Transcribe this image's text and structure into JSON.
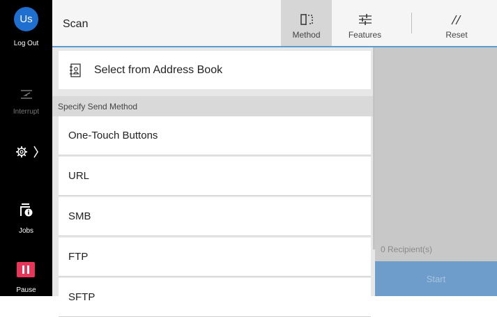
{
  "rail": {
    "user_initials": "Us",
    "logout_label": "Log Out",
    "interrupt_label": "Interrupt",
    "jobs_label": "Jobs",
    "pause_label": "Pause"
  },
  "header": {
    "title": "Scan",
    "tabs": [
      {
        "label": "Method",
        "icon": "method-icon",
        "active": true
      },
      {
        "label": "Features",
        "icon": "sliders-icon",
        "active": false
      },
      {
        "label": "Reset",
        "icon": "reset-slashes-icon",
        "active": false
      }
    ]
  },
  "main": {
    "address_book_label": "Select from Address Book",
    "section_header": "Specify Send Method",
    "methods": [
      "One-Touch Buttons",
      "URL",
      "SMB",
      "FTP",
      "SFTP"
    ]
  },
  "right": {
    "recipients": "0 Recipient(s)",
    "start_label": "Start"
  },
  "colors": {
    "accent": "#5b9bd5",
    "avatar": "#1f6fd1",
    "pause": "#e8365a",
    "start_disabled": "#6e9dcb"
  }
}
